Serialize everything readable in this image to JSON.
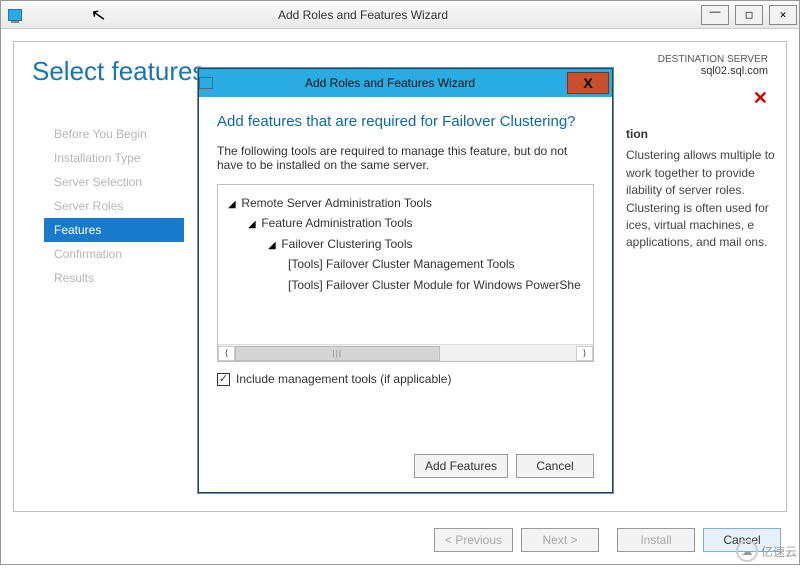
{
  "outer_window": {
    "title": "Add Roles and Features Wizard"
  },
  "page": {
    "title": "Select features",
    "destination_label": "DESTINATION SERVER",
    "destination_server": "sql02.sql.com"
  },
  "sidebar": {
    "items": [
      {
        "label": "Before You Begin"
      },
      {
        "label": "Installation Type"
      },
      {
        "label": "Server Selection"
      },
      {
        "label": "Server Roles"
      },
      {
        "label": "Features"
      },
      {
        "label": "Confirmation"
      },
      {
        "label": "Results"
      }
    ]
  },
  "description": {
    "heading_partial": "tion",
    "body_partial": "Clustering allows multiple to work together to provide ilability of server roles. Clustering is often used for ices, virtual machines, e applications, and mail ons."
  },
  "footer": {
    "previous": "< Previous",
    "next": "Next >",
    "install": "Install",
    "cancel": "Cancel"
  },
  "modal": {
    "title": "Add Roles and Features Wizard",
    "question": "Add features that are required for Failover Clustering?",
    "explain": "The following tools are required to manage this feature, but do not have to be installed on the same server.",
    "tree": {
      "n1": "Remote Server Administration Tools",
      "n2": "Feature Administration Tools",
      "n3": "Failover Clustering Tools",
      "n4a": "[Tools] Failover Cluster Management Tools",
      "n4b": "[Tools] Failover Cluster Module for Windows PowerShe"
    },
    "checkbox_label": "Include management tools (if applicable)",
    "add_btn": "Add Features",
    "cancel_btn": "Cancel"
  },
  "watermark": "亿速云"
}
